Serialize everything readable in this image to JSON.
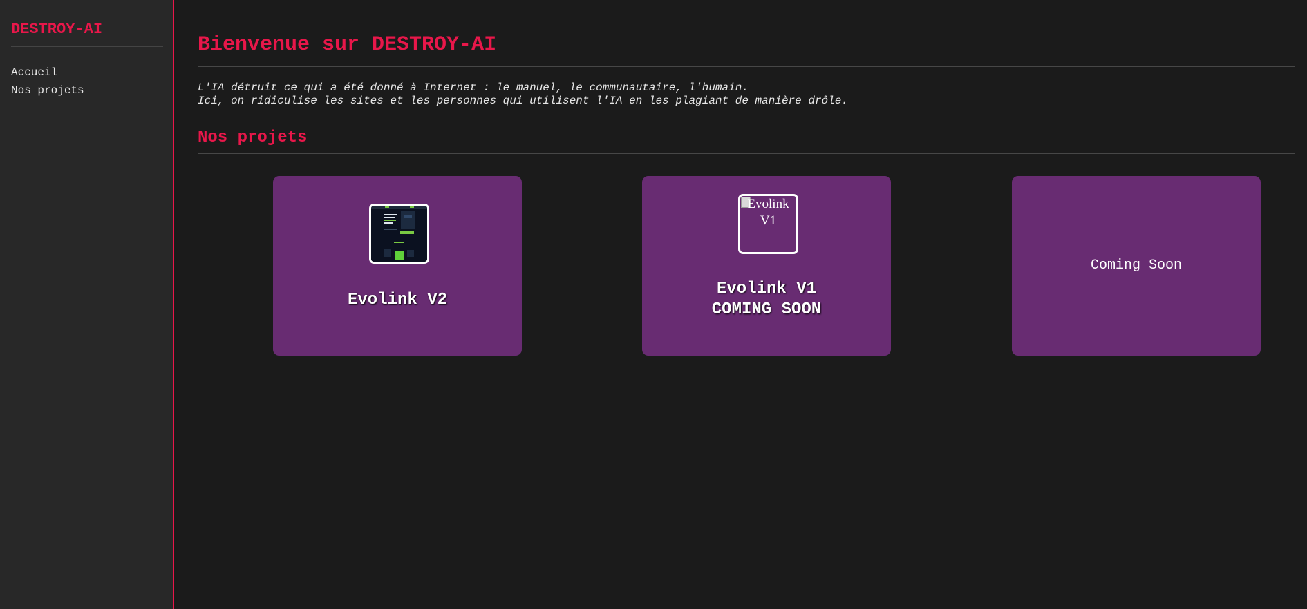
{
  "sidebar": {
    "brand": "DESTROY-AI",
    "nav": [
      {
        "label": "Accueil"
      },
      {
        "label": "Nos projets"
      }
    ]
  },
  "main": {
    "title": "Bienvenue sur DESTROY-AI",
    "intro_line1": "L'IA détruit ce qui a été donné à Internet : le manuel, le communautaire, l'humain.",
    "intro_line2": "Ici, on ridiculise les sites et les personnes qui utilisent l'IA en les plagiant de manière drôle.",
    "projects_heading": "Nos projets",
    "projects": [
      {
        "title": "Evolink V2"
      },
      {
        "title_line1": "Evolink V1",
        "title_line2": "COMING SOON",
        "image_alt": "Evolink V1"
      },
      {
        "label": "Coming Soon"
      }
    ]
  },
  "colors": {
    "accent": "#e8174a",
    "card": "#682c72",
    "background": "#1b1b1b",
    "sidebar": "#282828"
  }
}
